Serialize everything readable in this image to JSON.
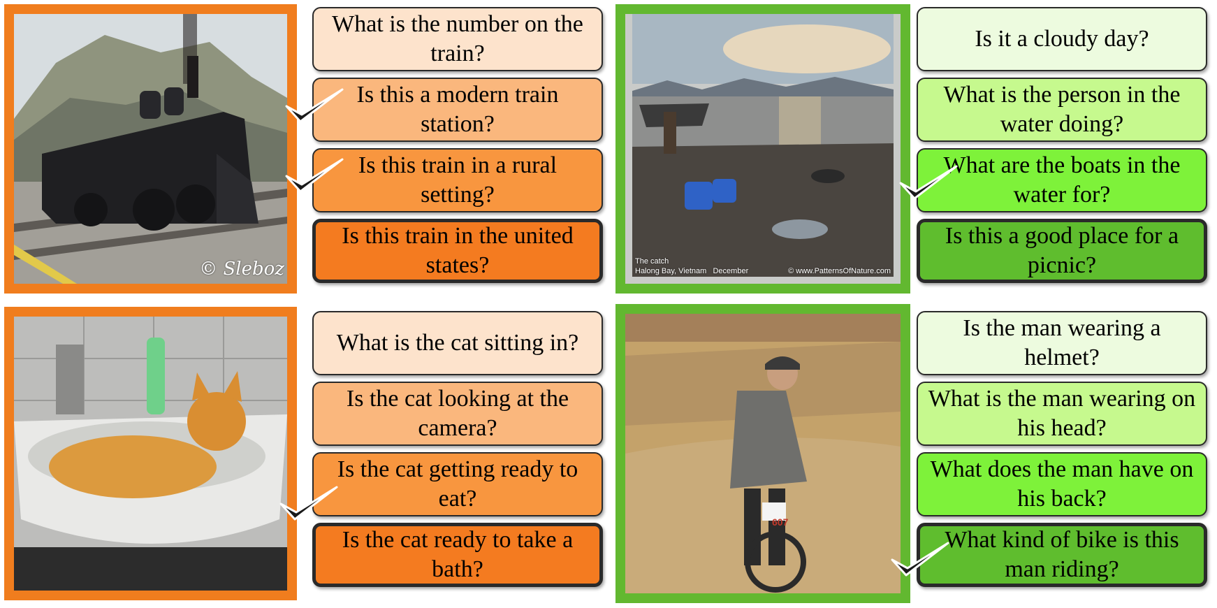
{
  "colors": {
    "orange_border": "#f07d1e",
    "green_border": "#62b830",
    "orange_shades": [
      "#fde3cc",
      "#fab77d",
      "#f8963f",
      "#f47b20"
    ],
    "green_shades": [
      "#edfbdf",
      "#c6f98e",
      "#7ef23a",
      "#5fbd2e"
    ]
  },
  "panels": [
    {
      "theme": "orange",
      "image": "steam-locomotive-photo",
      "watermark": "© Sleboz",
      "questions": [
        "What is the number on the train?",
        "Is this a modern train station?",
        "Is this train in a rural setting?",
        "Is this train in the united states?"
      ],
      "checked": [
        1,
        2
      ]
    },
    {
      "theme": "green",
      "image": "beach-boats-photo",
      "caption_line1": "The catch",
      "caption_line2": "Halong Bay, Vietnam   December",
      "caption_right": "© www.PatternsOfNature.com",
      "questions": [
        "Is it a cloudy day?",
        "What is the person in the water doing?",
        "What are the boats in the water for?",
        "Is this a good place for a picnic?"
      ],
      "checked": [
        2
      ]
    },
    {
      "theme": "orange",
      "image": "cat-in-sink-photo",
      "questions": [
        "What is the cat sitting in?",
        "Is the cat looking at the camera?",
        "Is the cat getting ready to eat?",
        "Is the cat ready to take a bath?"
      ],
      "checked": [
        2
      ]
    },
    {
      "theme": "green",
      "image": "mountain-biker-photo",
      "bib_number": "607",
      "questions": [
        "Is the man wearing a helmet?",
        "What is the man wearing on his head?",
        "What does the man have on his back?",
        "What kind of bike is this man riding?"
      ],
      "checked": [
        3
      ]
    }
  ]
}
